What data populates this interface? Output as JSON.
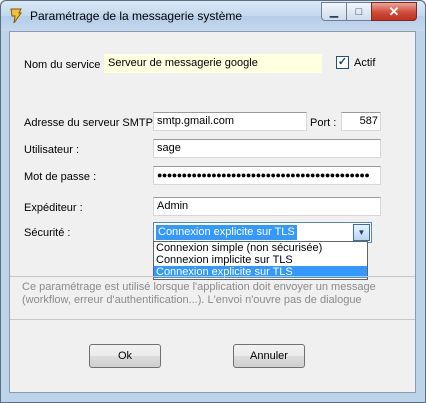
{
  "window": {
    "title": "Paramétrage de la messagerie système",
    "minimize_glyph": "▁",
    "maximize_glyph": "□",
    "close_glyph": "✕"
  },
  "form": {
    "service_name_label": "Nom du service :",
    "service_name_value": "Serveur de messagerie google",
    "active_label": "Actif",
    "active_checked": true,
    "active_check_glyph": "✓",
    "smtp_label": "Adresse du serveur SMTP :",
    "smtp_value": "smtp.gmail.com",
    "port_label": "Port :",
    "port_value": "587",
    "user_label": "Utilisateur :",
    "user_value": "sage",
    "password_label": "Mot de passe :",
    "password_value": "●●●●●●●●●●●●●●●●●●●●●●●●●●●●●●●●●●●●●●●●●●●",
    "sender_label": "Expéditeur :",
    "sender_value": "Admin",
    "security_label": "Sécurité :",
    "security_value": "Connexion explicite sur TLS",
    "security_options": [
      "Connexion simple (non sécurisée)",
      "Connexion implicite sur TLS",
      "Connexion explicite sur TLS"
    ],
    "security_selected_index": 2,
    "combo_arrow_glyph": "▼"
  },
  "help_text": "Ce paramétrage est utilisé lorsque l'application doit envoyer un message (workflow, erreur d'authentification...). L'envoi n'ouvre pas de dialogue",
  "buttons": {
    "ok_label": "Ok",
    "cancel_label": "Annuler"
  },
  "colors": {
    "selection": "#3399ff",
    "service_field_bg": "#ffffe1",
    "close_button": "#c2301c"
  }
}
